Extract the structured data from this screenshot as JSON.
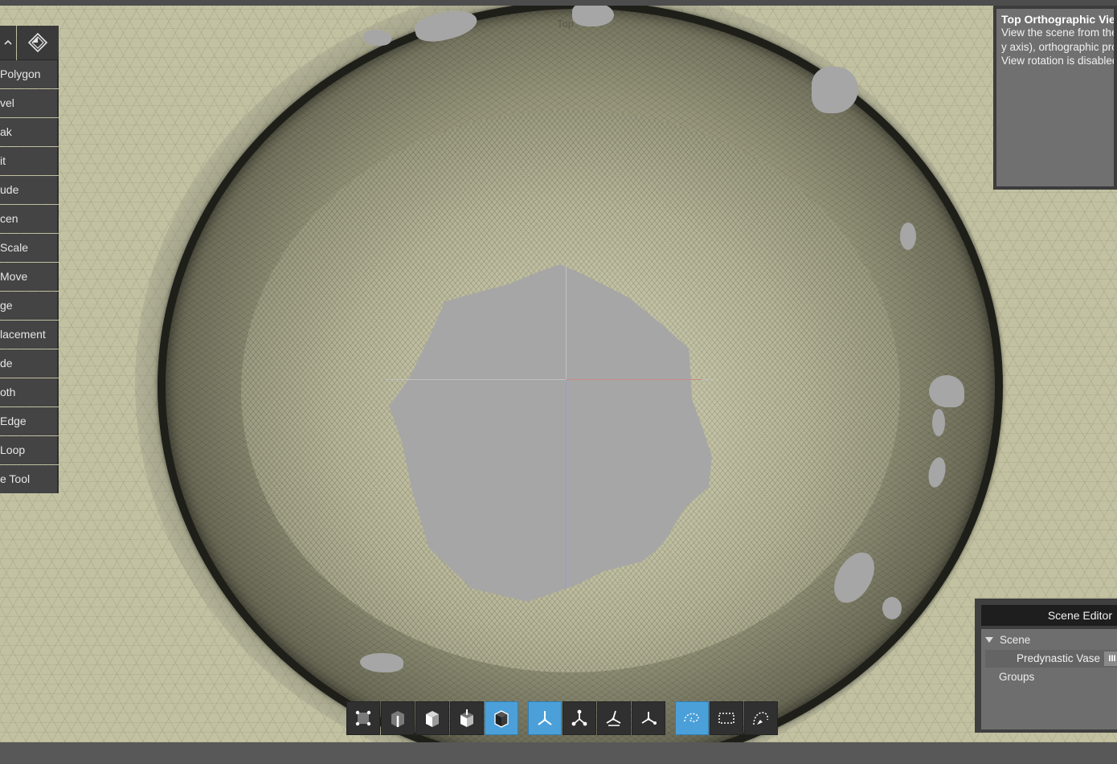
{
  "viewport": {
    "view_label": "Top"
  },
  "tool_panel": {
    "items": [
      "Polygon",
      "vel",
      "ak",
      "it",
      "ude",
      "cen",
      "Scale",
      "Move",
      "ge",
      "lacement",
      "de",
      "oth",
      "Edge",
      "Loop",
      "e Tool"
    ]
  },
  "tooltip": {
    "title": "Top Orthographic Vie",
    "lines": [
      "View the scene from the",
      "y axis), orthographic pro",
      "View rotation is disabled"
    ]
  },
  "scene_editor": {
    "title": "Scene Editor",
    "root": "Scene",
    "item": "Predynastic Vase",
    "visibility_glyph": "III",
    "groups": "Groups"
  },
  "toolbar": {
    "buttons": [
      {
        "icon": "vertex-select-icon",
        "active": false
      },
      {
        "icon": "edge-select-icon",
        "active": false
      },
      {
        "icon": "face-select-icon",
        "active": false
      },
      {
        "icon": "element-select-icon",
        "active": false
      },
      {
        "icon": "object-select-icon",
        "active": true
      },
      {
        "icon": "transform-global-icon",
        "active": true
      },
      {
        "icon": "transform-local-icon",
        "active": false
      },
      {
        "icon": "transform-normal-icon",
        "active": false
      },
      {
        "icon": "transform-screen-icon",
        "active": false
      },
      {
        "icon": "lasso-select-icon",
        "active": true
      },
      {
        "icon": "rect-select-icon",
        "active": false
      },
      {
        "icon": "paint-select-icon",
        "active": false
      }
    ]
  },
  "colors": {
    "accent": "#4ba0d9",
    "panel": "#444444",
    "mesh": "#c2c1a1"
  }
}
